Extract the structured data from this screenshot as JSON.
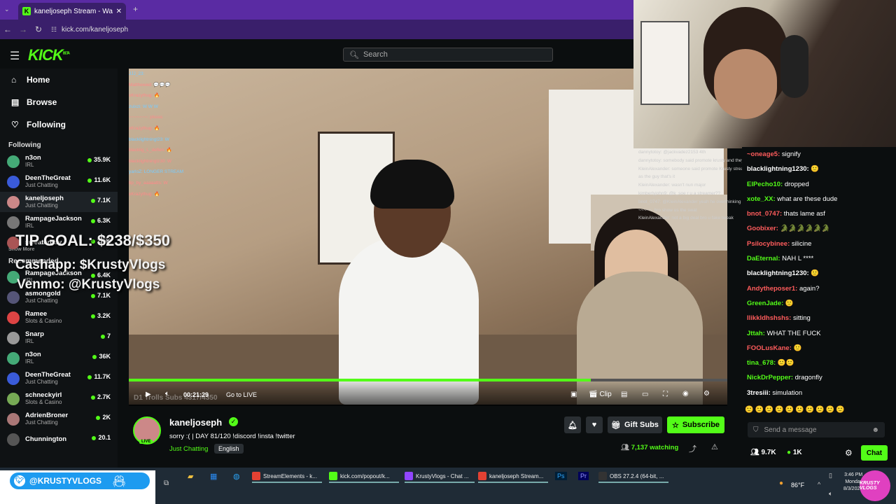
{
  "browser": {
    "tab_title": "kaneljoseph Stream - Watch Li...",
    "url": "kick.com/kaneljoseph"
  },
  "header": {
    "logo": "KICK",
    "logo_badge": "BETA",
    "search_placeholder": "Search"
  },
  "sidebar": {
    "nav": [
      {
        "label": "Home",
        "icon": "home-icon"
      },
      {
        "label": "Browse",
        "icon": "browse-icon"
      },
      {
        "label": "Following",
        "icon": "heart-icon"
      }
    ],
    "following_title": "Following",
    "following": [
      {
        "name": "n3on",
        "category": "IRL",
        "viewers": "35.9K"
      },
      {
        "name": "DeenTheGreat",
        "category": "Just Chatting",
        "viewers": "11.6K"
      },
      {
        "name": "kaneljoseph",
        "category": "Just Chatting",
        "viewers": "7.1K"
      },
      {
        "name": "RampageJackson",
        "category": "IRL",
        "viewers": "6.3K"
      },
      {
        "name": "sweaterguy",
        "category": "",
        "viewers": "2.5K"
      }
    ],
    "show_more": "Show More",
    "recommended_title": "Recommended",
    "recommended": [
      {
        "name": "RampageJackson",
        "category": "IRL",
        "viewers": "6.4K"
      },
      {
        "name": "asmongold",
        "category": "Just Chatting",
        "viewers": "7.1K"
      },
      {
        "name": "Ramee",
        "category": "Slots & Casino",
        "viewers": "3.2K"
      },
      {
        "name": "Snarp",
        "category": "IRL",
        "viewers": "7"
      },
      {
        "name": "n3on",
        "category": "IRL",
        "viewers": "36K"
      },
      {
        "name": "DeenTheGreat",
        "category": "Just Chatting",
        "viewers": "11.7K"
      },
      {
        "name": "schneckyirl",
        "category": "Slots & Casino",
        "viewers": "2.7K"
      },
      {
        "name": "AdrienBroner",
        "category": "Just Chatting",
        "viewers": "2K"
      },
      {
        "name": "Chunnington",
        "category": "",
        "viewers": "20.1"
      }
    ]
  },
  "video": {
    "tip_goal": "TIP GOAL: $238/$350",
    "cashapp": "Cashapp: $KrustyVlogs",
    "venmo": "Venmo: @KrustyVlogs",
    "overlay_chat": [
      "JJJ_23:",
      "Matthewed: 💬💬💬",
      "xKrazythug: 🔥",
      "zuixzi: W W W",
      "~~~~~~~: plssss",
      "xKrazythug: 🔥",
      "blacklightningl23: W",
      "blacklig_L_deflen: 🔥",
      "blacklightninglz30: W",
      "yarloZ: LONGER STREAM",
      "tip_by_aaaaatts: W",
      "xKrazythug: 🔥"
    ],
    "time": "00:21:29",
    "go_live": "Go to LIVE",
    "subs_overlay": "D1 Trolls Subs 4317/4350",
    "clip": "Clip",
    "progress": 0.772
  },
  "stream_info": {
    "name": "kaneljoseph",
    "title": "sorry :( | DAY 81/120 !discord !insta !twitter",
    "category": "Just Chatting",
    "language": "English",
    "live_badge": "LIVE",
    "watching": "7,137 watching",
    "gift_subs": "Gift Subs",
    "subscribe": "Subscribe"
  },
  "obs_chat": [
    "dannytotoy: @jackvadez2153 4th",
    "dannytotoy: somebody said promote krusty and they got banned",
    "KleinAlexander: someone said promote Krusty stream and then he said",
    "as the guy that's it",
    "KleinAlexander: wasn't nun major",
    "kimberlyjohn9: @k_soe r u a streamer??",
    "bnot_0747: @KleinAlexander yeah he overthinking it",
    "~~~~~: bro show us the swat",
    "KleinAlexander: not a big deal bro u fake tweak"
  ],
  "chat": {
    "messages": [
      {
        "user": "~oneage5:",
        "text": " signify",
        "color": "#ff5c5c"
      },
      {
        "user": "blacklightning1230:",
        "text": " 🙂",
        "color": "#ffffff"
      },
      {
        "user": "ElPecho10:",
        "text": " dropped",
        "color": "#53fc18"
      },
      {
        "user": "xote_XX:",
        "text": " what are these dude",
        "color": "#53fc18"
      },
      {
        "user": "bnot_0747:",
        "text": " thats lame asf",
        "color": "#ff5c5c"
      },
      {
        "user": "Goobixer:",
        "text": " 🐊🐊🐊🐊🐊🐊",
        "color": "#ff5c5c"
      },
      {
        "user": "Psilocybinee:",
        "text": " silicine",
        "color": "#ff5c5c"
      },
      {
        "user": "DaEternal:",
        "text": " NAH L ****",
        "color": "#53fc18"
      },
      {
        "user": "blacklightning1230:",
        "text": " 🙂",
        "color": "#ffffff"
      },
      {
        "user": "Andytheposer1:",
        "text": " again?",
        "color": "#ff5c5c"
      },
      {
        "user": "GreenJade:",
        "text": " 🙂",
        "color": "#53fc18"
      },
      {
        "user": "llikkldhshshs:",
        "text": " sitting",
        "color": "#ff5c5c"
      },
      {
        "user": "Jttah:",
        "text": " WHAT THE FUCK",
        "color": "#53fc18"
      },
      {
        "user": "FOOLusKane:",
        "text": " 🙂",
        "color": "#ff5c5c"
      },
      {
        "user": "tina_678:",
        "text": " 🙂🙂",
        "color": "#53fc18"
      },
      {
        "user": "NickDrPepper:",
        "text": " dragonfly",
        "color": "#53fc18"
      },
      {
        "user": "3tresiii:",
        "text": " simulation",
        "color": "#ffffff"
      }
    ],
    "placeholder": "Send a message",
    "followers": "9.7K",
    "kicks": "1K",
    "chat_btn": "Chat"
  },
  "taskbar": {
    "twitter": "@KRUSTYVLOGS",
    "apps": [
      {
        "label": "StreamElements - k...",
        "color": "#e34133"
      },
      {
        "label": "kick.com/popout/k...",
        "color": "#53fc18"
      },
      {
        "label": "KrustyVlogs - Chat ...",
        "color": "#9146ff"
      },
      {
        "label": "kaneljoseph Stream...",
        "color": "#e34133"
      },
      {
        "label": "OBS 27.2.4 (64-bit, ...",
        "color": "#333333"
      }
    ],
    "weather": "86°F",
    "time": "3:46 PM",
    "day": "Monday",
    "date": "8/3/2022"
  }
}
